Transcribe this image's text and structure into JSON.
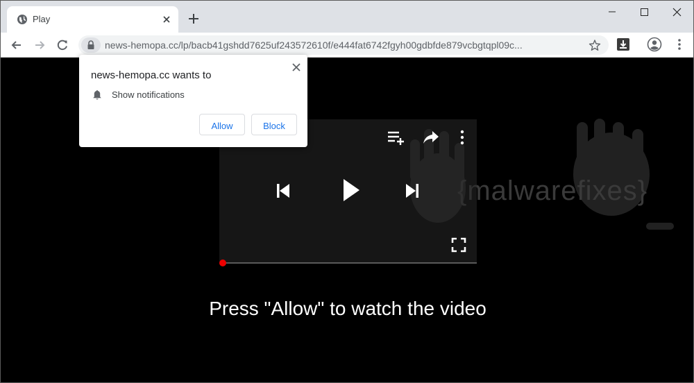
{
  "tab": {
    "title": "Play"
  },
  "omnibox": {
    "url": "news-hemopa.cc/lp/bacb41gshdd7625uf243572610f/e444fat6742fgyh00gdbfde879vcbgtqpl09c..."
  },
  "page": {
    "watermark_text": "{malwarefixes}",
    "prompt": "Press \"Allow\" to watch the video",
    "video_progress": 0
  },
  "permission_popup": {
    "title": "news-hemopa.cc wants to",
    "permission": "Show notifications",
    "allow_label": "Allow",
    "block_label": "Block"
  }
}
